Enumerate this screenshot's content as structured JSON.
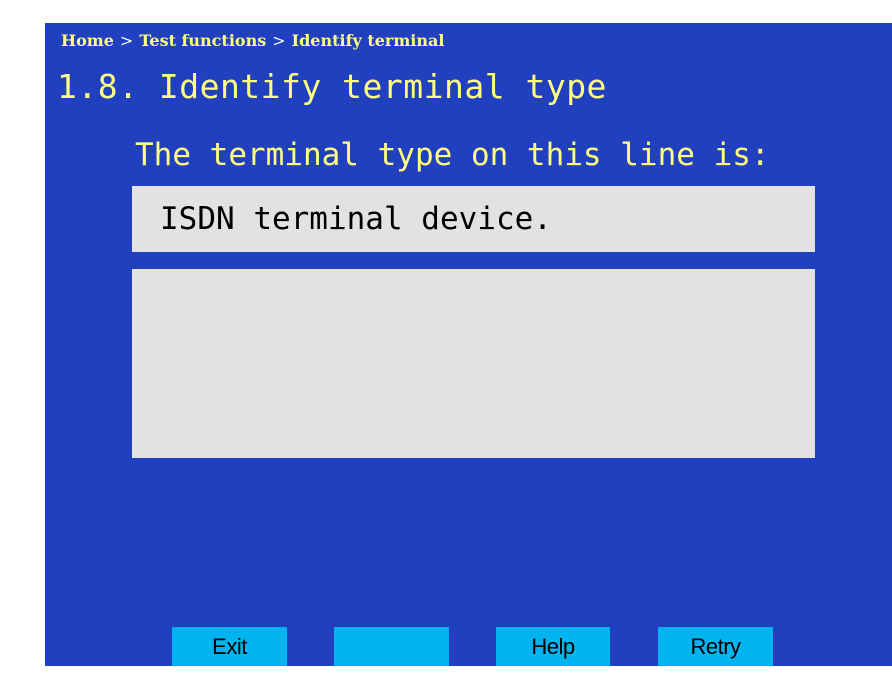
{
  "breadcrumb": {
    "items": [
      "Home",
      "Test functions",
      "Identify terminal"
    ],
    "separator": ">"
  },
  "page": {
    "title": "1.8. Identify terminal type",
    "prompt": "The terminal type on this line is:",
    "result": "ISDN terminal device.",
    "details": ""
  },
  "softkeys": {
    "exit": "Exit",
    "blank": "",
    "help": "Help",
    "retry": "Retry"
  },
  "colors": {
    "screen_background": "#2040c0",
    "heading_text": "#ffff80",
    "panel_background": "#e2e2e2",
    "softkey_background": "#00b4f0"
  }
}
